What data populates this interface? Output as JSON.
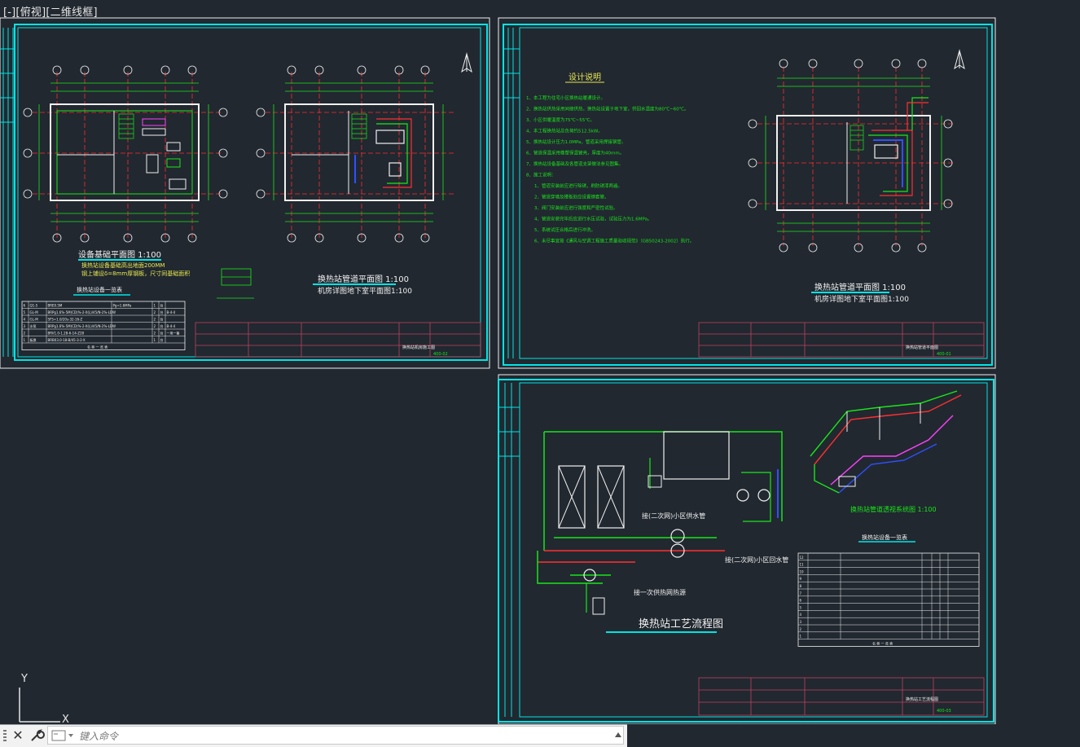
{
  "viewport": {
    "label": "[-][俯视][二维线框]"
  },
  "ucs": {
    "y_label": "Y",
    "x_label": "X"
  },
  "command_line": {
    "placeholder": "键入命令"
  },
  "colors": {
    "background": "#212830",
    "frame": "#00e5e5",
    "axis_red": "#ff2b2b",
    "pipe_green": "#19e619",
    "pipe_red": "#ff3030",
    "pipe_blue": "#3050ff",
    "pipe_magenta": "#ff40ff",
    "text_white": "#f0f0f0",
    "text_yellow": "#e8e850"
  },
  "sheets": {
    "left": {
      "plan1_title": "设备基础平面图 1:100",
      "plan1_note1": "换热站设备基础高出地面200MM",
      "plan1_note2": "钢上铺设δ=8mm厚钢板，尺寸同基础面积",
      "plan2_title": "换热站管道平面图 1:100",
      "plan2_subtitle": "机房详图地下室平面图1:100",
      "table_title": "换热站设备一览表",
      "table_rows": [
        [
          "6",
          "Q1-5",
          "BRE0.5M",
          "Pg=1.6MPa",
          "1",
          "台",
          ""
        ],
        [
          "5",
          "GL-M",
          "BRPg1.6%-5M(CD)%-2-X(L)/45/N-2%-LDW",
          "",
          "2",
          "台",
          "B-4-4"
        ],
        [
          "4",
          "GL-M",
          "SFS=1.0/20s-32-16-Z",
          "",
          "2",
          "台",
          ""
        ],
        [
          "3",
          "水泵",
          "BRPg1.6%-5M(CD)%-2-X(L)/45/N-2%-LDW",
          "",
          "2",
          "台",
          "B-4-4"
        ],
        [
          "2",
          "",
          "BRV1.0-1.28-6-14-Z28",
          "",
          "2",
          "台",
          "一用一备"
        ],
        [
          "1",
          "板换",
          "BRB03.0-18-B/45-3-2-X",
          "",
          "1",
          "台",
          ""
        ]
      ],
      "table_footer": "名  称  一  览  表",
      "title_block_text": "换热站机房施工图",
      "sheet_no": "400-02"
    },
    "top_right": {
      "notes_title": "设计说明",
      "notes": [
        "1、本工程为住宅小区换热站暖通设计。",
        "2、换热站供热采用间接供热，换热站设置于地下室，供回水温度为80℃~60℃。",
        "3、小区供暖温度为75℃~55℃。",
        "4、本工程换热站总负荷约512.5kW。",
        "5、换热站设计压力1.0MPa，管道采用焊接钢管。",
        "6、管道保温采用橡塑保温管壳，厚度为40mm。",
        "7、换热站设备基础及各管道支架做法参见图集。",
        "8、施工说明：",
        "1、管道安装前应进行除锈，刷防锈漆两遍。",
        "2、管道穿墙及楼板处应设置钢套管。",
        "3、阀门安装前应进行强度和严密性试验。",
        "4、管道安装完毕后应进行水压试验，试验压力为1.6MPa。",
        "5、系统试压合格后进行冲洗。",
        "6、未尽事宜按《通风与空调工程施工质量验收规范》（GB50243-2002）执行。"
      ],
      "plan_title": "换热站管道平面图 1:100",
      "plan_subtitle": "机房详图地下室平面图1:100",
      "title_block_text": "换热站管道平面图",
      "sheet_no": "400-01"
    },
    "bottom_right": {
      "flow_title": "换热站工艺流程图",
      "label_secondary_supply": "接(二次网)小区供水管",
      "label_secondary_return": "接(二次网)小区回水管",
      "label_primary": "接一次供热网热源",
      "iso_title": "换热站管道透视系统图 1:100",
      "table_title": "换热站设备一览表",
      "table_rows": [
        [
          "12",
          "",
          "",
          "",
          "",
          "",
          ""
        ],
        [
          "11",
          "",
          "",
          "",
          "",
          "",
          ""
        ],
        [
          "10",
          "",
          "",
          "",
          "",
          "",
          ""
        ],
        [
          "9",
          "",
          "",
          "",
          "",
          "",
          ""
        ],
        [
          "8",
          "",
          "",
          "",
          "",
          "",
          ""
        ],
        [
          "7",
          "",
          "",
          "",
          "",
          "",
          ""
        ],
        [
          "6",
          "",
          "",
          "",
          "",
          "",
          ""
        ],
        [
          "5",
          "",
          "",
          "",
          "",
          "",
          ""
        ],
        [
          "4",
          "",
          "",
          "",
          "",
          "",
          ""
        ],
        [
          "3",
          "",
          "",
          "",
          "",
          "",
          ""
        ],
        [
          "2",
          "",
          "",
          "",
          "",
          "",
          ""
        ],
        [
          "1",
          "",
          "",
          "",
          "",
          "",
          ""
        ]
      ],
      "table_footer": "名  称  一  览  表",
      "title_block_text": "换热站工艺流程图",
      "sheet_no": "400-03"
    }
  }
}
